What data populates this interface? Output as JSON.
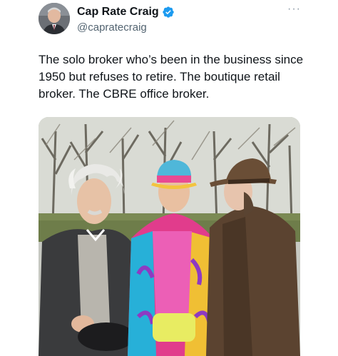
{
  "author": {
    "display_name": "Cap Rate Craig",
    "handle": "@capratecraig",
    "verified": true,
    "avatar_icon": "profile-photo"
  },
  "more_menu": {
    "icon": "more-dots-icon",
    "glyph": "···"
  },
  "tweet": {
    "text": "The solo broker who’s been in the business since 1950 but refuses to retire. The boutique retail broker. The CBRE office broker."
  },
  "colors": {
    "text_primary": "#0f1419",
    "text_secondary": "#536471",
    "verified_blue": "#1d9bf0"
  },
  "media": {
    "type": "photo",
    "description_icon": "photo-three-men-in-woods"
  }
}
